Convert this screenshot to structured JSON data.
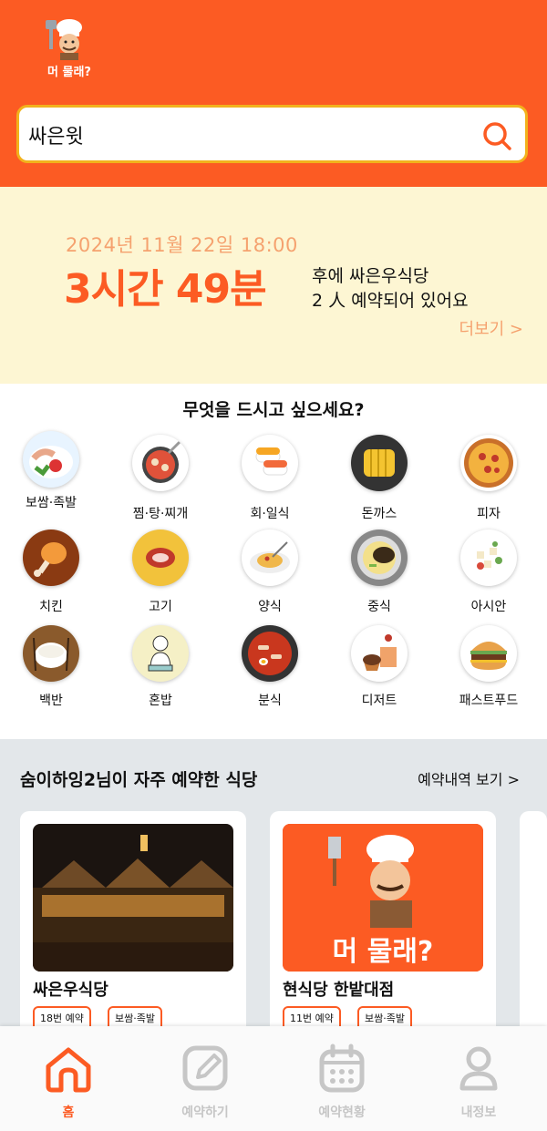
{
  "brand": {
    "logo_text": "머 물래?"
  },
  "search": {
    "value": "싸은윗"
  },
  "reservation": {
    "datetime": "2024년 11월 22일 18:00",
    "remaining": "3시간 49분",
    "line1": "후에 싸은우식당",
    "line2": "2 人 예약되어 있어요",
    "more": "더보기 >"
  },
  "categories": {
    "title": "무엇을 드시고 싶으세요?",
    "items": [
      {
        "label": "보쌈·족발",
        "icon": "bossam-icon"
      },
      {
        "label": "찜·탕·찌개",
        "icon": "stew-icon"
      },
      {
        "label": "회·일식",
        "icon": "sushi-icon"
      },
      {
        "label": "돈까스",
        "icon": "tonkatsu-icon"
      },
      {
        "label": "피자",
        "icon": "pizza-icon"
      },
      {
        "label": "치킨",
        "icon": "chicken-icon"
      },
      {
        "label": "고기",
        "icon": "meat-icon"
      },
      {
        "label": "양식",
        "icon": "pasta-icon"
      },
      {
        "label": "중식",
        "icon": "jjajang-icon"
      },
      {
        "label": "아시안",
        "icon": "asian-icon"
      },
      {
        "label": "백반",
        "icon": "rice-bowl-icon"
      },
      {
        "label": "혼밥",
        "icon": "solo-meal-icon"
      },
      {
        "label": "분식",
        "icon": "tteokbokki-icon"
      },
      {
        "label": "디저트",
        "icon": "dessert-icon"
      },
      {
        "label": "패스트푸드",
        "icon": "burger-icon"
      }
    ]
  },
  "frequent": {
    "title": "숨이하잉2님이 자주 예약한 식당",
    "link": "예약내역 보기 >",
    "cards": [
      {
        "name": "싸은우식당",
        "count": "18번 예약",
        "category": "보쌈·족발"
      },
      {
        "name": "현식당 한밭대점",
        "count": "11번 예약",
        "category": "보쌈·족발",
        "image_text": "머 물래?"
      }
    ]
  },
  "nav": {
    "items": [
      {
        "label": "홈",
        "icon": "home-icon",
        "active": true
      },
      {
        "label": "예약하기",
        "icon": "edit-icon",
        "active": false
      },
      {
        "label": "예약현황",
        "icon": "calendar-icon",
        "active": false
      },
      {
        "label": "내정보",
        "icon": "person-icon",
        "active": false
      }
    ]
  },
  "colors": {
    "accent": "#fc5b23",
    "banner_bg": "#fdf6d3",
    "search_border": "#f2b21c",
    "section_bg": "#e3e7ea"
  }
}
